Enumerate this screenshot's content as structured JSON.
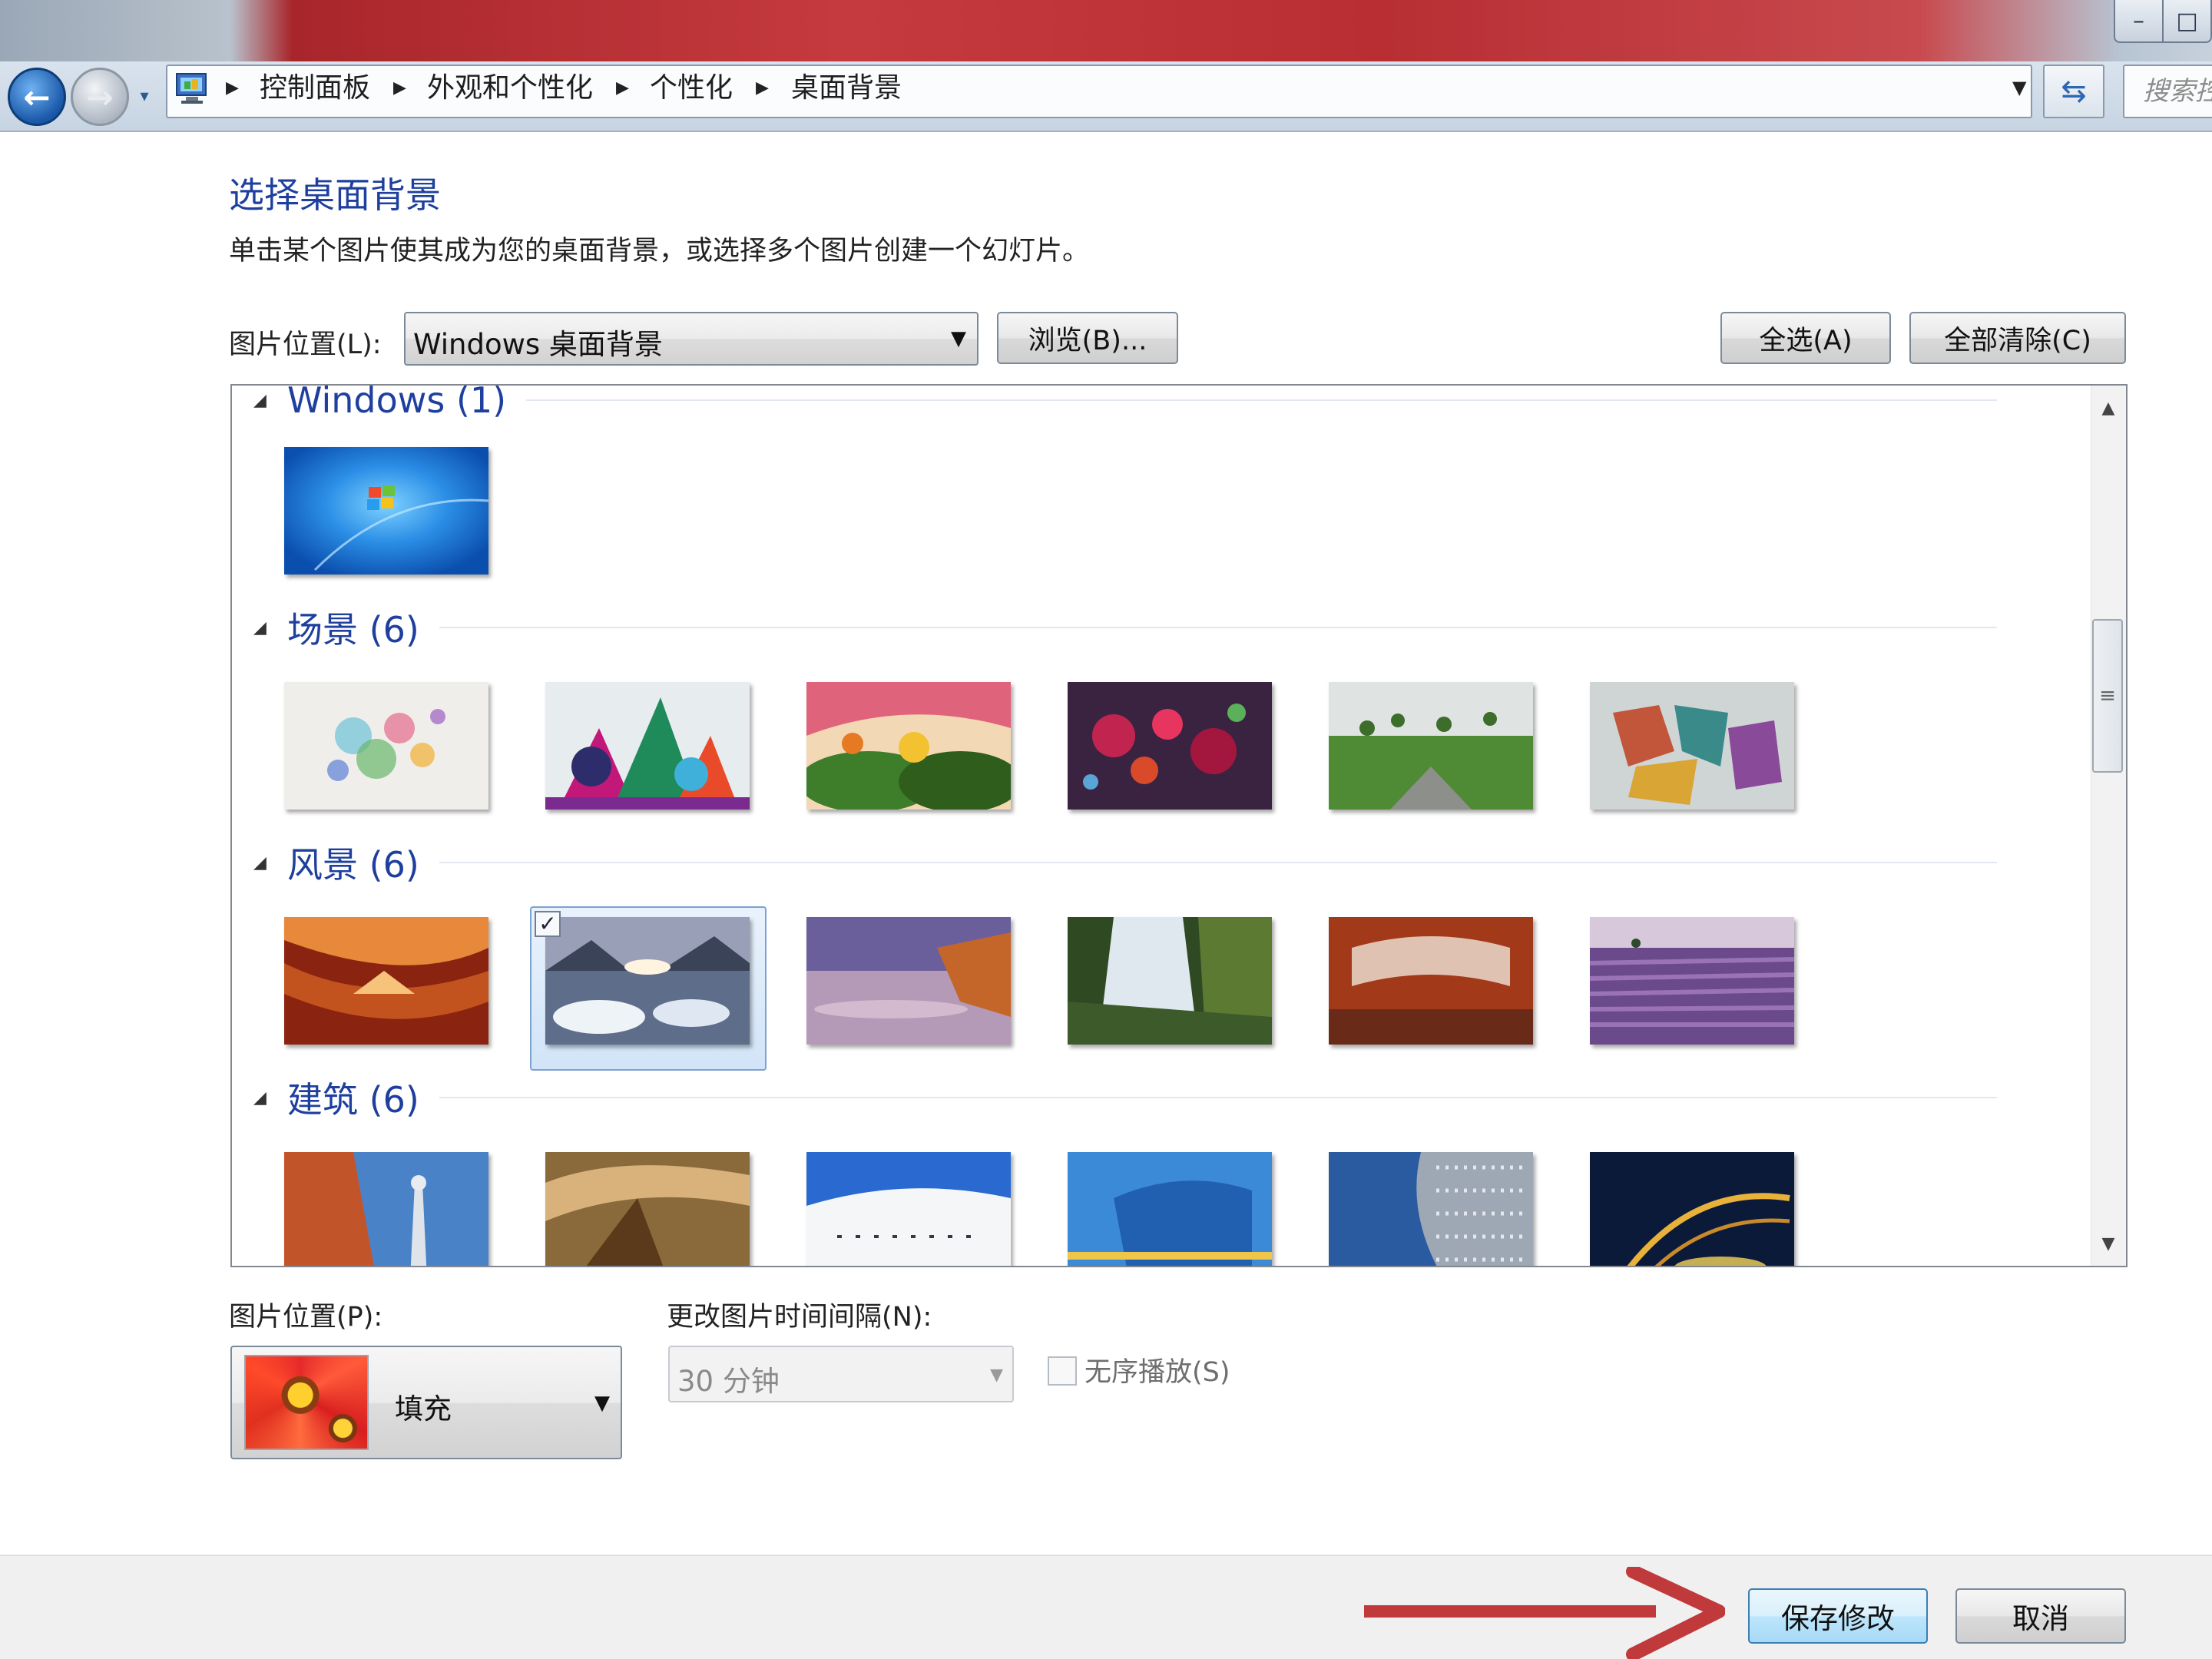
{
  "window": {
    "minimize_icon": "minimize-icon",
    "maximize_icon": "maximize-icon"
  },
  "nav": {
    "back_icon": "back-arrow-icon",
    "forward_icon": "forward-arrow-icon",
    "breadcrumbs": [
      "控制面板",
      "外观和个性化",
      "个性化",
      "桌面背景"
    ],
    "search_placeholder": "搜索控"
  },
  "header": {
    "title": "选择桌面背景",
    "description": "单击某个图片使其成为您的桌面背景，或选择多个图片创建一个幻灯片。"
  },
  "location": {
    "label": "图片位置(L):",
    "value": "Windows 桌面背景",
    "browse_label": "浏览(B)...",
    "select_all_label": "全选(A)",
    "clear_all_label": "全部清除(C)"
  },
  "gallery": {
    "groups": [
      {
        "name": "Windows (1)",
        "items": [
          {
            "name": "windows-7-logo",
            "selected": false
          }
        ]
      },
      {
        "name": "场景 (6)",
        "items": [
          {
            "name": "scene-1",
            "selected": false
          },
          {
            "name": "scene-2",
            "selected": false
          },
          {
            "name": "scene-3",
            "selected": false
          },
          {
            "name": "scene-4",
            "selected": false
          },
          {
            "name": "scene-5",
            "selected": false
          },
          {
            "name": "scene-6",
            "selected": false
          }
        ]
      },
      {
        "name": "风景 (6)",
        "items": [
          {
            "name": "landscape-canyon",
            "selected": false
          },
          {
            "name": "landscape-ice",
            "selected": true
          },
          {
            "name": "landscape-coast",
            "selected": false
          },
          {
            "name": "landscape-waterfall",
            "selected": false
          },
          {
            "name": "landscape-arch",
            "selected": false
          },
          {
            "name": "landscape-lavender",
            "selected": false
          }
        ]
      },
      {
        "name": "建筑 (6)",
        "items": [
          {
            "name": "architecture-1",
            "selected": false
          },
          {
            "name": "architecture-2",
            "selected": false
          },
          {
            "name": "architecture-3",
            "selected": false
          },
          {
            "name": "architecture-4",
            "selected": false
          },
          {
            "name": "architecture-5",
            "selected": false
          },
          {
            "name": "architecture-6",
            "selected": false
          }
        ]
      }
    ]
  },
  "position": {
    "label": "图片位置(P):",
    "value": "填充"
  },
  "interval": {
    "label": "更改图片时间间隔(N):",
    "value": "30 分钟"
  },
  "shuffle": {
    "label": "无序播放(S)",
    "checked": false
  },
  "footer": {
    "save_label": "保存修改",
    "cancel_label": "取消"
  },
  "colors": {
    "title_blue": "#1e3f9e",
    "annotation_arrow": "#c0393b",
    "primary_button_border": "#3c7fb1"
  }
}
